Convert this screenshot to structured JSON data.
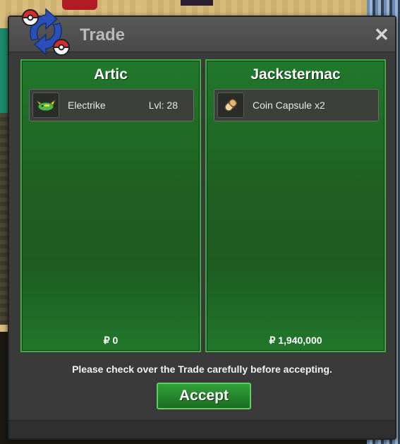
{
  "window": {
    "title": "Trade",
    "close_icon": "close-icon",
    "logo_icon": "trade-swap-icon"
  },
  "players": [
    {
      "name": "Artic",
      "item": {
        "name": "Electrike",
        "level": "Lvl: 28",
        "icon": "electrike-icon"
      },
      "money": "₽ 0"
    },
    {
      "name": "Jackstermac",
      "item": {
        "name": "Coin Capsule  x2",
        "icon": "coin-capsule-icon"
      },
      "money": "₽ 1,940,000"
    }
  ],
  "notice": "Please check over the Trade carefully before accepting.",
  "accept_label": "Accept",
  "colors": {
    "panel_green": "#1f5f22",
    "panel_border": "#3ab043",
    "window": "#3a3a3a",
    "titlebar": "#505050"
  }
}
